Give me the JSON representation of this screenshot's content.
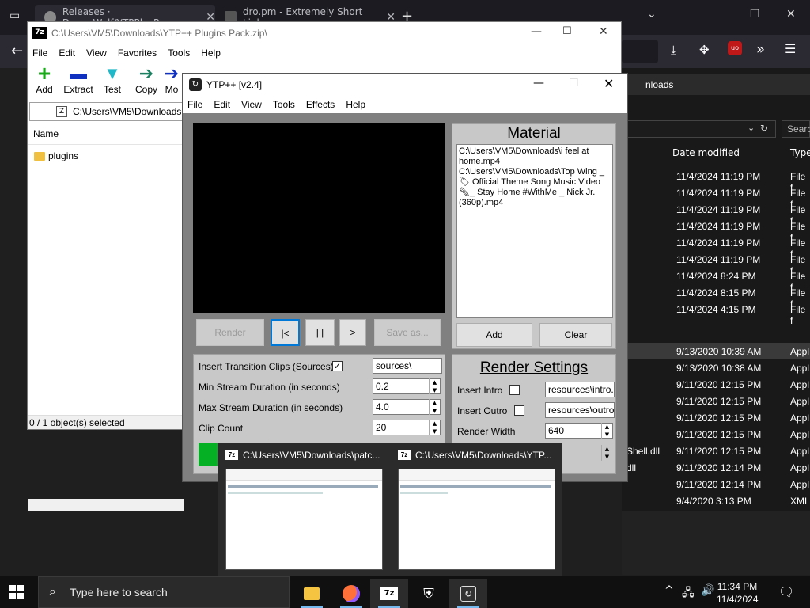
{
  "browser": {
    "tabs": [
      {
        "label": "Releases · DevanWolf/YTPPlusP"
      },
      {
        "label": "dro.pm - Extremely Short Links"
      }
    ],
    "new_tab": "+",
    "window_controls": {
      "list": "⌄",
      "restore": "❐",
      "close": "✕"
    }
  },
  "explorer": {
    "breadcrumb_tail": "nloads",
    "search_placeholder": "Searc",
    "columns": {
      "date_modified": "Date modified",
      "type": "Type"
    },
    "rows": [
      {
        "date": "11/4/2024 11:19 PM",
        "type": "File f"
      },
      {
        "date": "11/4/2024 11:19 PM",
        "type": "File f"
      },
      {
        "date": "11/4/2024 11:19 PM",
        "type": "File f"
      },
      {
        "date": "11/4/2024 11:19 PM",
        "type": "File f"
      },
      {
        "date": "11/4/2024 11:19 PM",
        "type": "File f"
      },
      {
        "date": "11/4/2024 11:19 PM",
        "type": "File f"
      },
      {
        "date": "11/4/2024 8:24 PM",
        "type": "File f"
      },
      {
        "date": "11/4/2024 8:15 PM",
        "type": "File f"
      },
      {
        "date": "11/4/2024 4:15 PM",
        "type": "File f"
      },
      {
        "date": "9/13/2020 10:39 AM",
        "type": "Appl"
      },
      {
        "date": "9/13/2020 10:38 AM",
        "type": "Appl"
      },
      {
        "date": "9/11/2020 12:15 PM",
        "type": "Appl"
      },
      {
        "date": "9/11/2020 12:15 PM",
        "type": "Appl"
      },
      {
        "date": "9/11/2020 12:15 PM",
        "type": "Appl"
      },
      {
        "date": "9/11/2020 12:15 PM",
        "type": "Appl"
      },
      {
        "date": "9/11/2020 12:15 PM",
        "type": "Appl"
      },
      {
        "date": "9/11/2020 12:14 PM",
        "type": "Appl"
      },
      {
        "date": "9/11/2020 12:14 PM",
        "type": "Appl"
      },
      {
        "date": "9/4/2020 3:13 PM",
        "type": "XML"
      }
    ],
    "partial_names": {
      "shell_dll": "Shell.dll",
      "dll": "dll"
    }
  },
  "zip": {
    "title": "C:\\Users\\VM5\\Downloads\\YTP++ Plugins Pack.zip\\",
    "logo": "7z",
    "menu": [
      "File",
      "Edit",
      "View",
      "Favorites",
      "Tools",
      "Help"
    ],
    "toolbar": [
      {
        "label": "Add",
        "glyph": "+",
        "icon": "add-icon",
        "color": "#18a818"
      },
      {
        "label": "Extract",
        "glyph": "▬",
        "icon": "extract-icon",
        "color": "#1030c0"
      },
      {
        "label": "Test",
        "glyph": "▼",
        "icon": "test-icon",
        "color": "#20b8c8"
      },
      {
        "label": "Copy",
        "glyph": "➔",
        "icon": "copy-icon",
        "color": "#1a8060"
      },
      {
        "label": "Mo",
        "glyph": "➔",
        "icon": "move-icon",
        "color": "#1030c0"
      }
    ],
    "address": "C:\\Users\\VM5\\Downloads",
    "column_name": "Name",
    "items": [
      {
        "name": "plugins"
      }
    ],
    "status": "0 / 1 object(s) selected"
  },
  "ytp": {
    "title": "YTP++ [v2.4]",
    "menu": [
      "File",
      "Edit",
      "View",
      "Tools",
      "Effects",
      "Help"
    ],
    "controls": {
      "render": "Render",
      "back": "|<",
      "pause": "| |",
      "play": ">",
      "save_as": "Save as..."
    },
    "material": {
      "heading": "Material",
      "items": [
        "C:\\Users\\VM5\\Downloads\\i feel at home.mp4",
        "C:\\Users\\VM5\\Downloads\\Top Wing _ 🏷 Official Theme Song Music Video ✏_ Stay Home #WithMe _ Nick Jr. (360p).mp4"
      ],
      "add": "Add",
      "clear": "Clear"
    },
    "options": {
      "insert_transitions": {
        "label": "Insert Transition Clips (Sources)",
        "checked": true,
        "value": "sources\\"
      },
      "min_stream": {
        "label": "Min Stream Duration (in seconds)",
        "value": "0.2"
      },
      "max_stream": {
        "label": "Max Stream Duration (in seconds)",
        "value": "4.0"
      },
      "clip_count": {
        "label": "Clip Count",
        "value": "20"
      }
    },
    "render_settings": {
      "heading": "Render Settings",
      "insert_intro": {
        "label": "Insert Intro",
        "checked": false,
        "value": "resources\\intro.r"
      },
      "insert_outro": {
        "label": "Insert Outro",
        "checked": false,
        "value": "resources\\outro."
      },
      "render_width": {
        "label": "Render Width",
        "value": "640"
      }
    },
    "progress_color": "#06b025"
  },
  "thumbnails": [
    {
      "title": "C:\\Users\\VM5\\Downloads\\patc..."
    },
    {
      "title": "C:\\Users\\VM5\\Downloads\\YTP..."
    }
  ],
  "taskbar": {
    "search_placeholder": "Type here to search",
    "time": "11:34 PM",
    "date": "11/4/2024",
    "icons": [
      "file-explorer-icon",
      "firefox-icon",
      "7zip-icon",
      "security-icon",
      "ytp-icon"
    ],
    "tray": {
      "chevron": "^",
      "network": "🖧",
      "volume": "🔊"
    }
  }
}
